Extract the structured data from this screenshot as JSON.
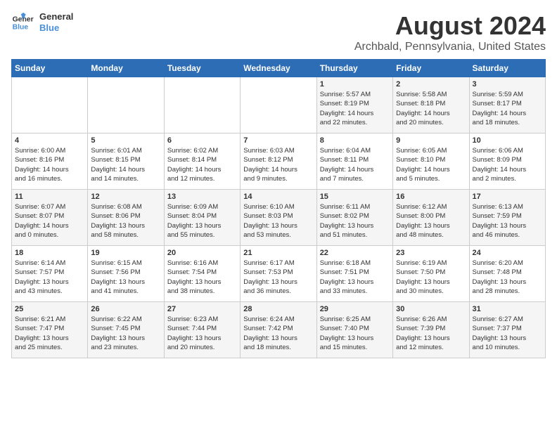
{
  "header": {
    "logo_line1": "General",
    "logo_line2": "Blue",
    "title": "August 2024",
    "subtitle": "Archbald, Pennsylvania, United States"
  },
  "weekdays": [
    "Sunday",
    "Monday",
    "Tuesday",
    "Wednesday",
    "Thursday",
    "Friday",
    "Saturday"
  ],
  "weeks": [
    [
      {
        "day": "",
        "info": ""
      },
      {
        "day": "",
        "info": ""
      },
      {
        "day": "",
        "info": ""
      },
      {
        "day": "",
        "info": ""
      },
      {
        "day": "1",
        "info": "Sunrise: 5:57 AM\nSunset: 8:19 PM\nDaylight: 14 hours\nand 22 minutes."
      },
      {
        "day": "2",
        "info": "Sunrise: 5:58 AM\nSunset: 8:18 PM\nDaylight: 14 hours\nand 20 minutes."
      },
      {
        "day": "3",
        "info": "Sunrise: 5:59 AM\nSunset: 8:17 PM\nDaylight: 14 hours\nand 18 minutes."
      }
    ],
    [
      {
        "day": "4",
        "info": "Sunrise: 6:00 AM\nSunset: 8:16 PM\nDaylight: 14 hours\nand 16 minutes."
      },
      {
        "day": "5",
        "info": "Sunrise: 6:01 AM\nSunset: 8:15 PM\nDaylight: 14 hours\nand 14 minutes."
      },
      {
        "day": "6",
        "info": "Sunrise: 6:02 AM\nSunset: 8:14 PM\nDaylight: 14 hours\nand 12 minutes."
      },
      {
        "day": "7",
        "info": "Sunrise: 6:03 AM\nSunset: 8:12 PM\nDaylight: 14 hours\nand 9 minutes."
      },
      {
        "day": "8",
        "info": "Sunrise: 6:04 AM\nSunset: 8:11 PM\nDaylight: 14 hours\nand 7 minutes."
      },
      {
        "day": "9",
        "info": "Sunrise: 6:05 AM\nSunset: 8:10 PM\nDaylight: 14 hours\nand 5 minutes."
      },
      {
        "day": "10",
        "info": "Sunrise: 6:06 AM\nSunset: 8:09 PM\nDaylight: 14 hours\nand 2 minutes."
      }
    ],
    [
      {
        "day": "11",
        "info": "Sunrise: 6:07 AM\nSunset: 8:07 PM\nDaylight: 14 hours\nand 0 minutes."
      },
      {
        "day": "12",
        "info": "Sunrise: 6:08 AM\nSunset: 8:06 PM\nDaylight: 13 hours\nand 58 minutes."
      },
      {
        "day": "13",
        "info": "Sunrise: 6:09 AM\nSunset: 8:04 PM\nDaylight: 13 hours\nand 55 minutes."
      },
      {
        "day": "14",
        "info": "Sunrise: 6:10 AM\nSunset: 8:03 PM\nDaylight: 13 hours\nand 53 minutes."
      },
      {
        "day": "15",
        "info": "Sunrise: 6:11 AM\nSunset: 8:02 PM\nDaylight: 13 hours\nand 51 minutes."
      },
      {
        "day": "16",
        "info": "Sunrise: 6:12 AM\nSunset: 8:00 PM\nDaylight: 13 hours\nand 48 minutes."
      },
      {
        "day": "17",
        "info": "Sunrise: 6:13 AM\nSunset: 7:59 PM\nDaylight: 13 hours\nand 46 minutes."
      }
    ],
    [
      {
        "day": "18",
        "info": "Sunrise: 6:14 AM\nSunset: 7:57 PM\nDaylight: 13 hours\nand 43 minutes."
      },
      {
        "day": "19",
        "info": "Sunrise: 6:15 AM\nSunset: 7:56 PM\nDaylight: 13 hours\nand 41 minutes."
      },
      {
        "day": "20",
        "info": "Sunrise: 6:16 AM\nSunset: 7:54 PM\nDaylight: 13 hours\nand 38 minutes."
      },
      {
        "day": "21",
        "info": "Sunrise: 6:17 AM\nSunset: 7:53 PM\nDaylight: 13 hours\nand 36 minutes."
      },
      {
        "day": "22",
        "info": "Sunrise: 6:18 AM\nSunset: 7:51 PM\nDaylight: 13 hours\nand 33 minutes."
      },
      {
        "day": "23",
        "info": "Sunrise: 6:19 AM\nSunset: 7:50 PM\nDaylight: 13 hours\nand 30 minutes."
      },
      {
        "day": "24",
        "info": "Sunrise: 6:20 AM\nSunset: 7:48 PM\nDaylight: 13 hours\nand 28 minutes."
      }
    ],
    [
      {
        "day": "25",
        "info": "Sunrise: 6:21 AM\nSunset: 7:47 PM\nDaylight: 13 hours\nand 25 minutes."
      },
      {
        "day": "26",
        "info": "Sunrise: 6:22 AM\nSunset: 7:45 PM\nDaylight: 13 hours\nand 23 minutes."
      },
      {
        "day": "27",
        "info": "Sunrise: 6:23 AM\nSunset: 7:44 PM\nDaylight: 13 hours\nand 20 minutes."
      },
      {
        "day": "28",
        "info": "Sunrise: 6:24 AM\nSunset: 7:42 PM\nDaylight: 13 hours\nand 18 minutes."
      },
      {
        "day": "29",
        "info": "Sunrise: 6:25 AM\nSunset: 7:40 PM\nDaylight: 13 hours\nand 15 minutes."
      },
      {
        "day": "30",
        "info": "Sunrise: 6:26 AM\nSunset: 7:39 PM\nDaylight: 13 hours\nand 12 minutes."
      },
      {
        "day": "31",
        "info": "Sunrise: 6:27 AM\nSunset: 7:37 PM\nDaylight: 13 hours\nand 10 minutes."
      }
    ]
  ]
}
